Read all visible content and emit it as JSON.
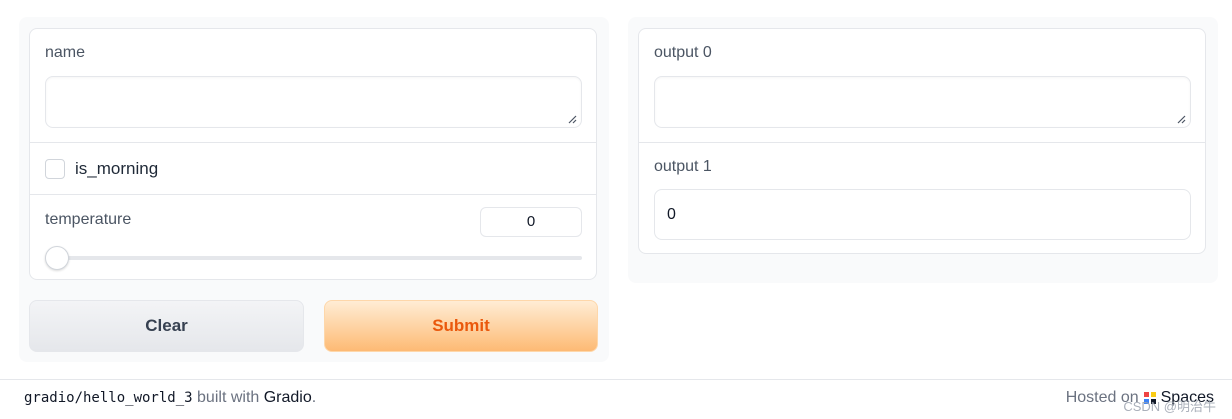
{
  "inputs": {
    "name_label": "name",
    "name_value": "",
    "checkbox_label": "is_morning",
    "checkbox_checked": false,
    "temperature_label": "temperature",
    "temperature_value": "0",
    "temperature_slider_level": 0
  },
  "buttons": {
    "clear_label": "Clear",
    "submit_label": "Submit"
  },
  "outputs": {
    "output0_label": "output 0",
    "output0_value": "",
    "output1_label": "output 1",
    "output1_value": "0"
  },
  "footer": {
    "repo": "gradio/hello_world_3",
    "built_with": "built with",
    "brand": "Gradio",
    "period": ".",
    "hosted_on": "Hosted on",
    "spaces": "Spaces",
    "watermark": "CSDN @明治牛"
  },
  "colors": {
    "submit_text": "#ea580c",
    "submit_bg": "#fdba74",
    "border": "#e5e7eb"
  },
  "icons": {
    "footer_spaces": "huggingface-icon",
    "textarea_resize": "resize-handle-icon"
  }
}
